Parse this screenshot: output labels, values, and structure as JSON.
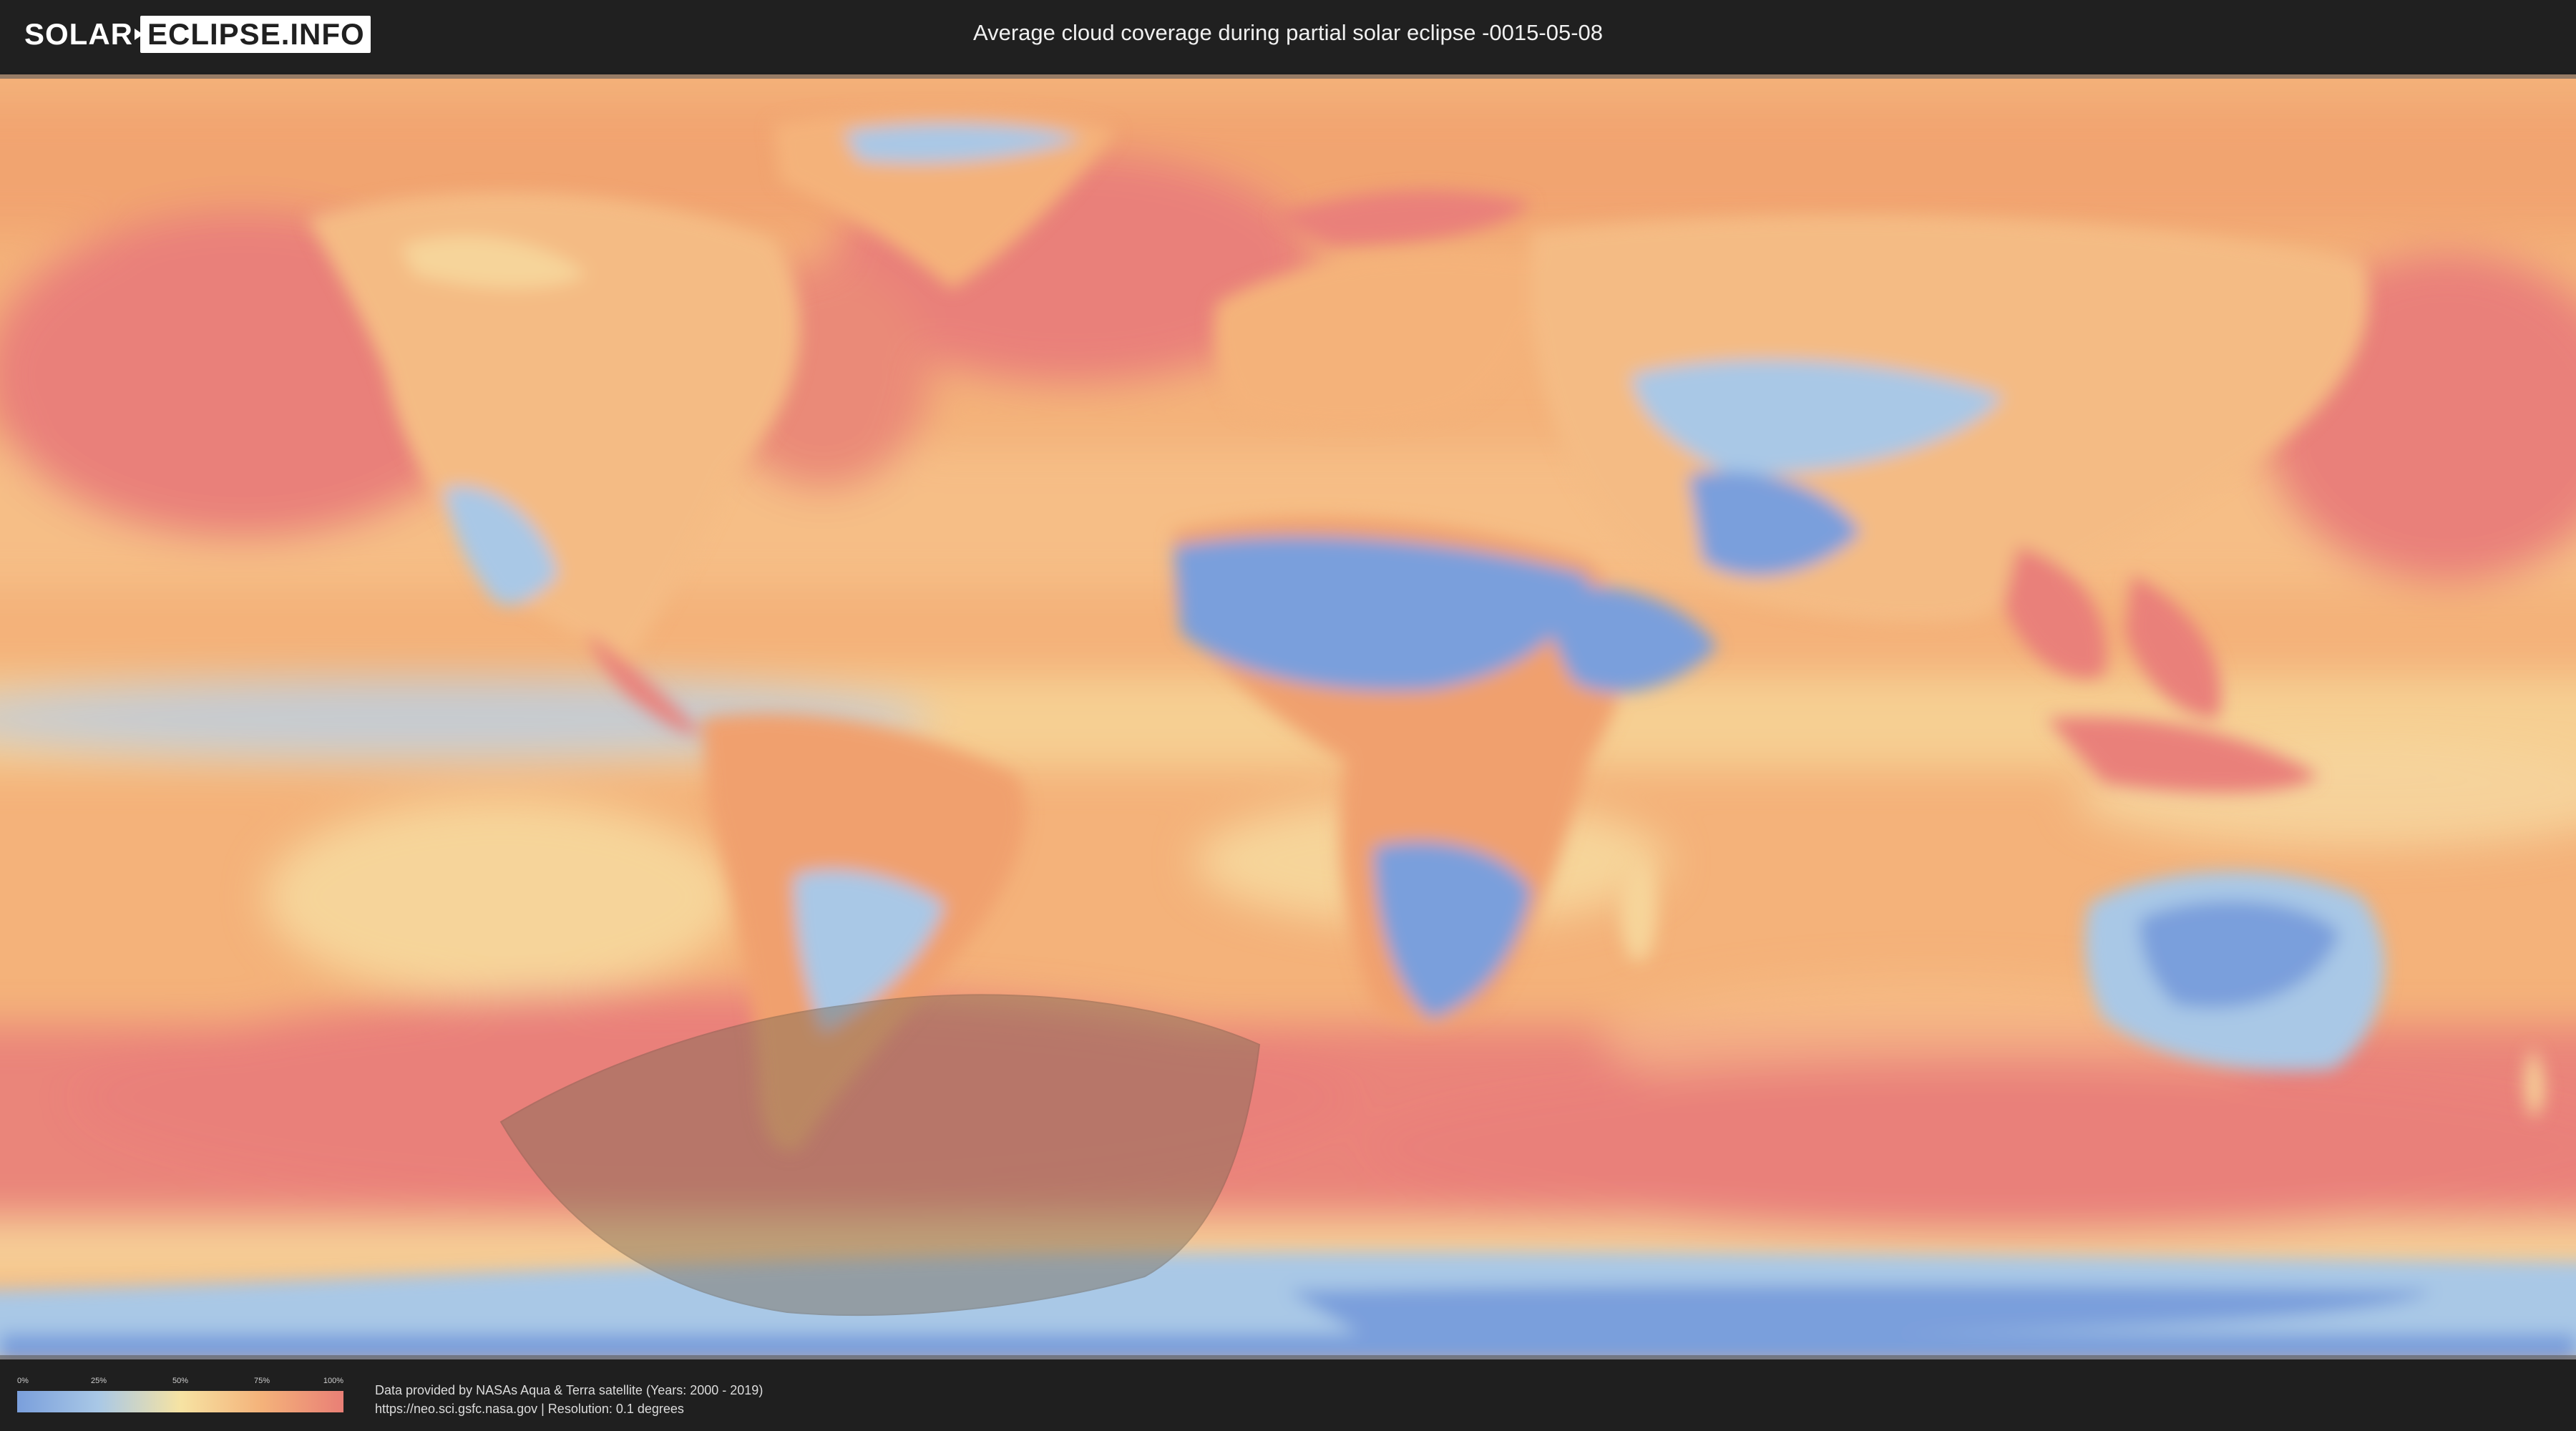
{
  "header": {
    "logo_left": "SOLAR",
    "logo_right": "ECLIPSE.INFO",
    "title": "Average cloud coverage during partial solar eclipse -0015-05-08"
  },
  "map": {
    "icon": "world-cloud-map",
    "colors": {
      "clear": "#7a9fdc",
      "low": "#a9c8e6",
      "mid": "#f6e3a3",
      "high": "#f4b27a",
      "overcast": "#e97f76",
      "eclipse_zone": "#7a6a55"
    }
  },
  "legend": {
    "ticks": [
      "0%",
      "25%",
      "50%",
      "75%",
      "100%"
    ]
  },
  "credits": {
    "line1": "Data provided by NASAs Aqua & Terra satellite (Years: 2000 - 2019)",
    "line2": "https://neo.sci.gsfc.nasa.gov | Resolution: 0.1 degrees"
  }
}
